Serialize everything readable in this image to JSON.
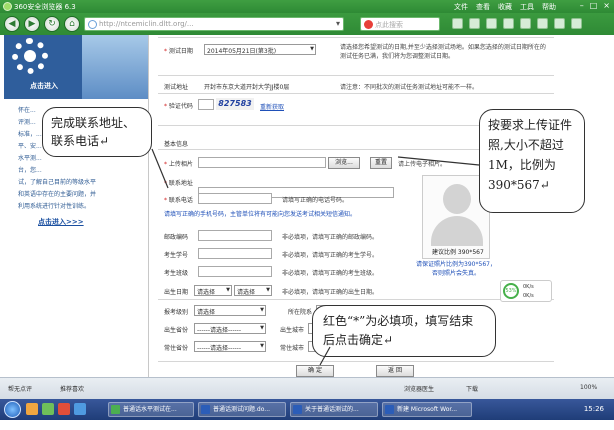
{
  "browser": {
    "title": "360安全浏览器 6.3",
    "menu": [
      "文件",
      "查看",
      "收藏",
      "工具",
      "帮助"
    ],
    "address": "http://ntcemiclin.dltt.org/...",
    "search_placeholder": "点此搜索"
  },
  "sidebar": {
    "enter_label": "点击进入",
    "text_lines": [
      "怀在...",
      "评测...",
      "标准，...",
      "平、安...",
      "水平测...",
      "台，您...",
      "试，了解自己目前的等级水平",
      "和英语中存在的主要问题，并",
      "利用系统进行针对性训练。"
    ],
    "link": "点击进入>>>"
  },
  "form": {
    "test_date_label": "测试日期",
    "test_date_value": "2014年05月21日(第3批)",
    "test_date_hint": "请选择您希望测试的日期,并至少选择测试场地。如果您选择的测试日期所在的测试任务已满，我们将为您调整测试日期。",
    "test_site_label": "测试地址",
    "test_site_value": "开封市东京大道开封大学JJ楼0层",
    "test_site_hint": "请注意：不同批次的测试任务测试地址可能不一样。",
    "captcha_label": "验证代码",
    "captcha_value": "827583",
    "captcha_refresh": "重新获取",
    "basic_info_title": "基本信息",
    "upload_label": "上传相片",
    "browse_btn": "浏览...",
    "upload_btn": "重置",
    "upload_hint": "请上传电子相片。",
    "address_label": "联系地址",
    "phone_label": "联系电话",
    "phone_hint": "请填写正确的电话号码。",
    "phone_blue_hint": "请填写正确的手机号码，主管单位将有可能向您发送考试相关短信通知。",
    "postcode_label": "邮政编码",
    "postcode_hint": "非必填项，请填写正确的邮政编码。",
    "student_no_label": "考生学号",
    "student_no_hint": "非必填项，请填写正确的考生学号。",
    "class_label": "考生班级",
    "class_hint": "非必填项，请填写正确的考生班级。",
    "birth_label": "出生日期",
    "birth_select1": "请选择",
    "birth_select2": "请选择",
    "birth_hint": "非必填项，请填写正确的出生日期。",
    "level_label": "报考级别",
    "level_value": "请选择",
    "area_label": "所在院系",
    "birth_prov_label": "出生省份",
    "birth_prov_value": "------请选择------",
    "birth_city_label": "出生城市",
    "birth_city_value": "------请选择------",
    "res_prov_label": "常住省份",
    "res_prov_value": "------请选择------",
    "res_city_label": "常住城市",
    "confirm_btn": "确  定",
    "back_btn": "返  回",
    "photo_ratio": "建议比例 390*567",
    "photo_note": "请保证照片比例为390*567，否则照片会失真。"
  },
  "callouts": {
    "c1": "完成联系地址、联系电话↵",
    "c2": "按要求上传证件照,大小不超过1M，比例为390*567↵",
    "c3": "红色“*”为必填项，填写结束后点击确定↵"
  },
  "widget": {
    "percent": "53%",
    "k1": "0K/s",
    "k2": "0K/s"
  },
  "statusbar": {
    "left1": "帮无点评",
    "left2": "推荐喜欢",
    "center": "浏览器医生",
    "download": "下载",
    "zoom": "100%"
  },
  "taskbar": {
    "items": [
      "普通话水平测试在...",
      "普通话测试问题.do...",
      "关于普通话测试的...",
      "新建 Microsoft Wor..."
    ],
    "clock": "15:26"
  },
  "colors": {
    "chrome_green": "#2f8a35",
    "required": "#d12020",
    "hint_blue": "#1f50b8",
    "taskbar": "#1f3d78"
  }
}
